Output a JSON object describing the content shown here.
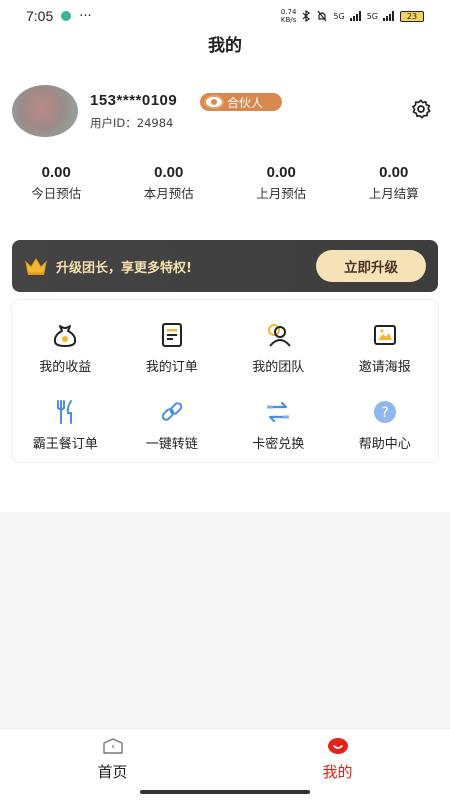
{
  "status_bar": {
    "time": "7:05",
    "more": "···",
    "net_speed_value": "0.74",
    "net_speed_unit": "KB/s",
    "signal1": "5G",
    "signal2": "5G",
    "battery": "23"
  },
  "header": {
    "title": "我的"
  },
  "profile": {
    "phone": "153****0109",
    "badge": "合伙人",
    "user_id": "用户ID：24984"
  },
  "stats": [
    {
      "value": "0.00",
      "label": "今日预估"
    },
    {
      "value": "0.00",
      "label": "本月预估"
    },
    {
      "value": "0.00",
      "label": "上月预估"
    },
    {
      "value": "0.00",
      "label": "上月结算"
    }
  ],
  "upgrade": {
    "text": "升级团长，享更多特权!",
    "button": "立即升级"
  },
  "menu": [
    {
      "label": "我的收益",
      "icon": "money-bag-icon"
    },
    {
      "label": "我的订单",
      "icon": "order-doc-icon"
    },
    {
      "label": "我的团队",
      "icon": "team-icon"
    },
    {
      "label": "邀请海报",
      "icon": "poster-icon"
    },
    {
      "label": "霸王餐订单",
      "icon": "utensils-icon"
    },
    {
      "label": "一键转链",
      "icon": "link-icon"
    },
    {
      "label": "卡密兑换",
      "icon": "exchange-icon"
    },
    {
      "label": "帮助中心",
      "icon": "help-icon"
    }
  ],
  "nav": [
    {
      "label": "首页",
      "icon": "home-icon"
    },
    {
      "label": "我的",
      "icon": "mine-icon",
      "active": true
    }
  ],
  "colors": {
    "accent": "#e2231a",
    "badge": "#d7894f",
    "banner": "#444444",
    "banner_btn": "#f7e1b6"
  }
}
